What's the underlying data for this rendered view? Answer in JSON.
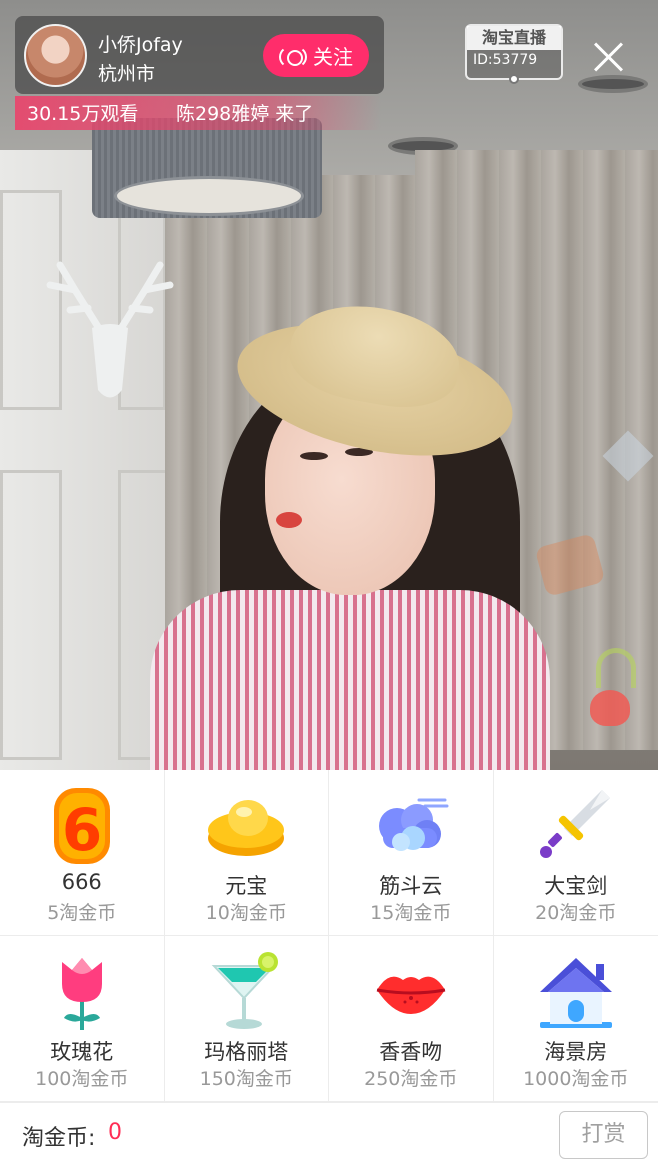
{
  "host": {
    "name": "小侨Jofay",
    "city": "杭州市",
    "follow_label": "关注"
  },
  "stream": {
    "viewers": "30.15万观看",
    "join_message": "陈298雅婷 来了",
    "platform_logo": "淘宝直播",
    "room_id": "ID:53779"
  },
  "gifts": [
    {
      "name": "666",
      "price": "5淘金币",
      "icon": "six-icon"
    },
    {
      "name": "元宝",
      "price": "10淘金币",
      "icon": "gold-ingot-icon"
    },
    {
      "name": "筋斗云",
      "price": "15淘金币",
      "icon": "cloud-icon"
    },
    {
      "name": "大宝剑",
      "price": "20淘金币",
      "icon": "sword-icon"
    },
    {
      "name": "玫瑰花",
      "price": "100淘金币",
      "icon": "rose-icon"
    },
    {
      "name": "玛格丽塔",
      "price": "150淘金币",
      "icon": "cocktail-icon"
    },
    {
      "name": "香香吻",
      "price": "250淘金币",
      "icon": "kiss-lips-icon"
    },
    {
      "name": "海景房",
      "price": "1000淘金币",
      "icon": "house-icon"
    }
  ],
  "wallet": {
    "label": "淘金币:",
    "balance": "0",
    "tip_label": "打赏"
  },
  "colors": {
    "accent": "#ff2d6b",
    "balance": "#ff2d55",
    "viewer_bar": "#e9456c"
  }
}
